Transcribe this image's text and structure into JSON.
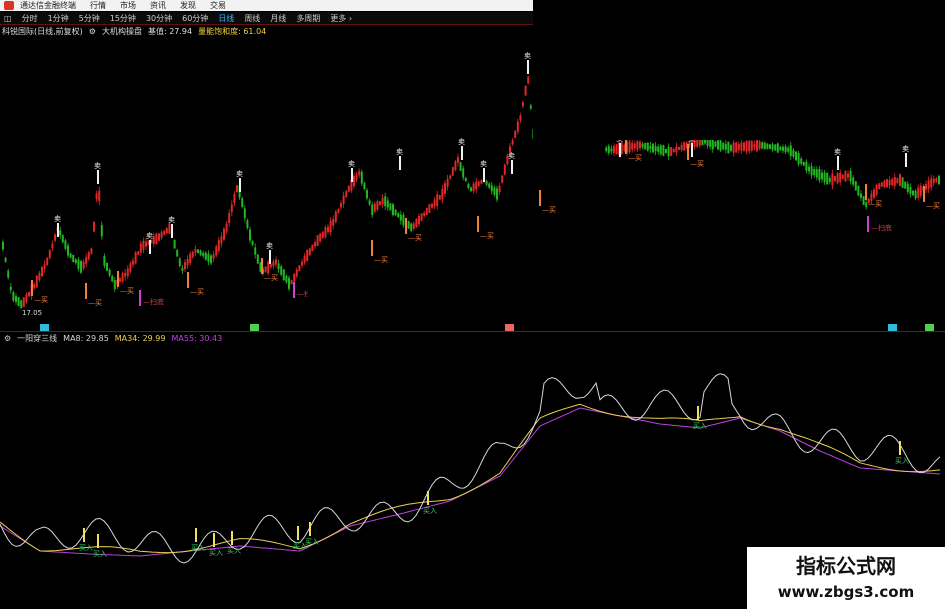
{
  "app": {
    "title": "通达信金融终端",
    "menus": [
      "行情",
      "市场",
      "资讯",
      "发现",
      "交易"
    ]
  },
  "periods": {
    "items": [
      "分时",
      "1分钟",
      "5分钟",
      "15分钟",
      "30分钟",
      "60分钟",
      "日线",
      "周线",
      "月线",
      "多周期",
      "更多 ›"
    ],
    "active_index": 6
  },
  "main_panel": {
    "stock": "科锐国际(日线,前复权)",
    "indicator": "大机构操盘",
    "base_label": "基值: 27.94",
    "energy_label": "量能饱和度: 61.04",
    "low_label": "17.05",
    "signal_buy_label": "买",
    "signal_sell_label": "卖",
    "signal_sweep_label": "扫底"
  },
  "sub_panel": {
    "name": "一阳穿三线",
    "ma8": "MA8: 29.85",
    "ma34": "MA34: 29.99",
    "ma55": "MA55: 30.43",
    "buy_label": "买入"
  },
  "colors": {
    "up": "#e02828",
    "down": "#22b822",
    "ma8": "#d8d8d8",
    "ma34": "#e8d050",
    "ma55": "#c040e0",
    "signal_orange": "#f08040",
    "buy_green": "#30d060"
  },
  "watermark": {
    "title": "指标公式网",
    "url": "www.zbgs3.com"
  }
}
